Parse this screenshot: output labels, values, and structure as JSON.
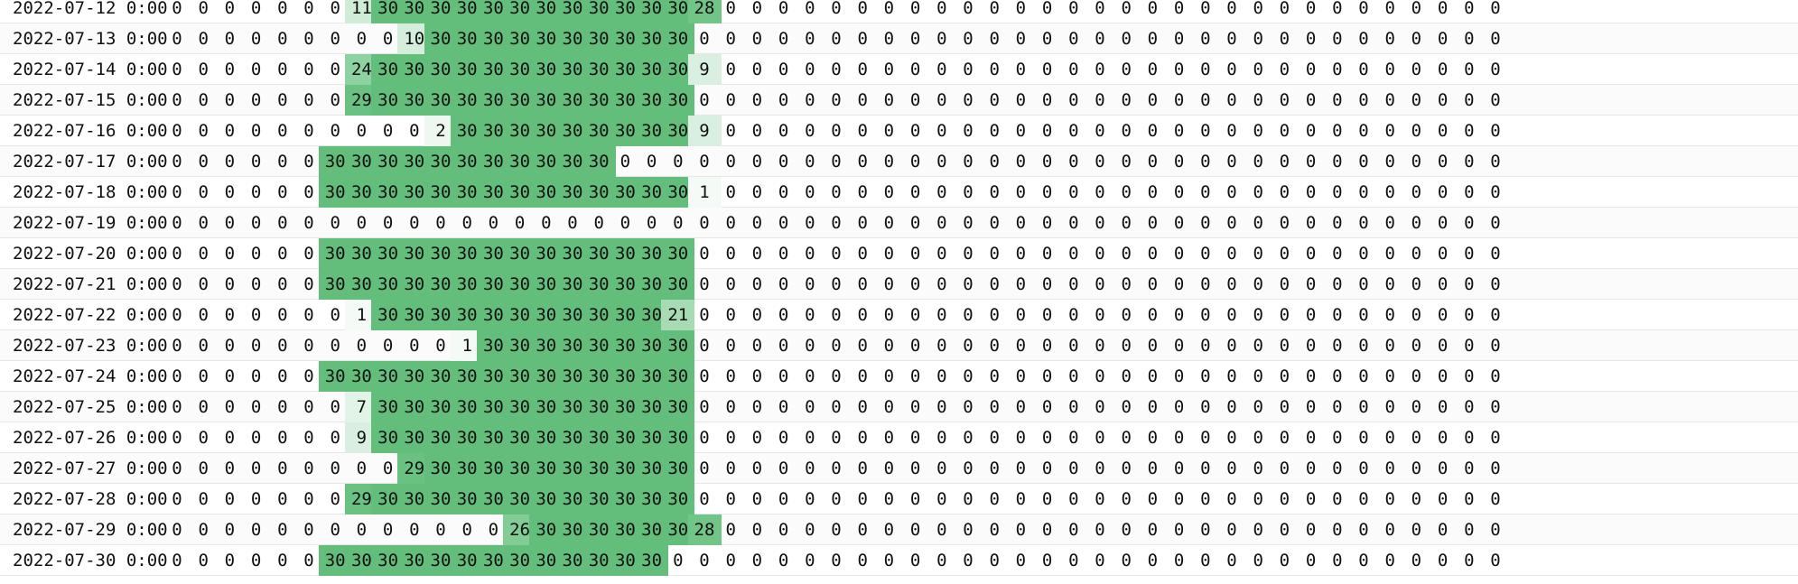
{
  "sheet": {
    "rows": [
      {
        "date": "2022-07-12 0:00",
        "values": [
          0,
          0,
          0,
          0,
          0,
          0,
          0,
          11,
          30,
          30,
          30,
          30,
          30,
          30,
          30,
          30,
          30,
          30,
          30,
          30,
          28,
          0,
          0,
          0,
          0,
          0,
          0,
          0,
          0,
          0,
          0,
          0,
          0,
          0,
          0,
          0,
          0,
          0,
          0,
          0,
          0,
          0,
          0,
          0,
          0,
          0,
          0,
          0,
          0,
          0,
          0
        ]
      },
      {
        "date": "2022-07-13 0:00",
        "values": [
          0,
          0,
          0,
          0,
          0,
          0,
          0,
          0,
          0,
          10,
          30,
          30,
          30,
          30,
          30,
          30,
          30,
          30,
          30,
          30,
          0,
          0,
          0,
          0,
          0,
          0,
          0,
          0,
          0,
          0,
          0,
          0,
          0,
          0,
          0,
          0,
          0,
          0,
          0,
          0,
          0,
          0,
          0,
          0,
          0,
          0,
          0,
          0,
          0,
          0,
          0
        ]
      },
      {
        "date": "2022-07-14 0:00",
        "values": [
          0,
          0,
          0,
          0,
          0,
          0,
          0,
          24,
          30,
          30,
          30,
          30,
          30,
          30,
          30,
          30,
          30,
          30,
          30,
          30,
          9,
          0,
          0,
          0,
          0,
          0,
          0,
          0,
          0,
          0,
          0,
          0,
          0,
          0,
          0,
          0,
          0,
          0,
          0,
          0,
          0,
          0,
          0,
          0,
          0,
          0,
          0,
          0,
          0,
          0,
          0
        ]
      },
      {
        "date": "2022-07-15 0:00",
        "values": [
          0,
          0,
          0,
          0,
          0,
          0,
          0,
          29,
          30,
          30,
          30,
          30,
          30,
          30,
          30,
          30,
          30,
          30,
          30,
          30,
          0,
          0,
          0,
          0,
          0,
          0,
          0,
          0,
          0,
          0,
          0,
          0,
          0,
          0,
          0,
          0,
          0,
          0,
          0,
          0,
          0,
          0,
          0,
          0,
          0,
          0,
          0,
          0,
          0,
          0,
          0
        ]
      },
      {
        "date": "2022-07-16 0:00",
        "values": [
          0,
          0,
          0,
          0,
          0,
          0,
          0,
          0,
          0,
          0,
          2,
          30,
          30,
          30,
          30,
          30,
          30,
          30,
          30,
          30,
          9,
          0,
          0,
          0,
          0,
          0,
          0,
          0,
          0,
          0,
          0,
          0,
          0,
          0,
          0,
          0,
          0,
          0,
          0,
          0,
          0,
          0,
          0,
          0,
          0,
          0,
          0,
          0,
          0,
          0,
          0
        ]
      },
      {
        "date": "2022-07-17 0:00",
        "values": [
          0,
          0,
          0,
          0,
          0,
          0,
          30,
          30,
          30,
          30,
          30,
          30,
          30,
          30,
          30,
          30,
          30,
          0,
          0,
          0,
          0,
          0,
          0,
          0,
          0,
          0,
          0,
          0,
          0,
          0,
          0,
          0,
          0,
          0,
          0,
          0,
          0,
          0,
          0,
          0,
          0,
          0,
          0,
          0,
          0,
          0,
          0,
          0,
          0,
          0,
          0
        ]
      },
      {
        "date": "2022-07-18 0:00",
        "values": [
          0,
          0,
          0,
          0,
          0,
          0,
          30,
          30,
          30,
          30,
          30,
          30,
          30,
          30,
          30,
          30,
          30,
          30,
          30,
          30,
          1,
          0,
          0,
          0,
          0,
          0,
          0,
          0,
          0,
          0,
          0,
          0,
          0,
          0,
          0,
          0,
          0,
          0,
          0,
          0,
          0,
          0,
          0,
          0,
          0,
          0,
          0,
          0,
          0,
          0,
          0
        ]
      },
      {
        "date": "2022-07-19 0:00",
        "values": [
          0,
          0,
          0,
          0,
          0,
          0,
          0,
          0,
          0,
          0,
          0,
          0,
          0,
          0,
          0,
          0,
          0,
          0,
          0,
          0,
          0,
          0,
          0,
          0,
          0,
          0,
          0,
          0,
          0,
          0,
          0,
          0,
          0,
          0,
          0,
          0,
          0,
          0,
          0,
          0,
          0,
          0,
          0,
          0,
          0,
          0,
          0,
          0,
          0,
          0,
          0
        ]
      },
      {
        "date": "2022-07-20 0:00",
        "values": [
          0,
          0,
          0,
          0,
          0,
          0,
          30,
          30,
          30,
          30,
          30,
          30,
          30,
          30,
          30,
          30,
          30,
          30,
          30,
          30,
          0,
          0,
          0,
          0,
          0,
          0,
          0,
          0,
          0,
          0,
          0,
          0,
          0,
          0,
          0,
          0,
          0,
          0,
          0,
          0,
          0,
          0,
          0,
          0,
          0,
          0,
          0,
          0,
          0,
          0,
          0
        ]
      },
      {
        "date": "2022-07-21 0:00",
        "values": [
          0,
          0,
          0,
          0,
          0,
          0,
          30,
          30,
          30,
          30,
          30,
          30,
          30,
          30,
          30,
          30,
          30,
          30,
          30,
          30,
          0,
          0,
          0,
          0,
          0,
          0,
          0,
          0,
          0,
          0,
          0,
          0,
          0,
          0,
          0,
          0,
          0,
          0,
          0,
          0,
          0,
          0,
          0,
          0,
          0,
          0,
          0,
          0,
          0,
          0,
          0
        ]
      },
      {
        "date": "2022-07-22 0:00",
        "values": [
          0,
          0,
          0,
          0,
          0,
          0,
          0,
          1,
          30,
          30,
          30,
          30,
          30,
          30,
          30,
          30,
          30,
          30,
          30,
          21,
          0,
          0,
          0,
          0,
          0,
          0,
          0,
          0,
          0,
          0,
          0,
          0,
          0,
          0,
          0,
          0,
          0,
          0,
          0,
          0,
          0,
          0,
          0,
          0,
          0,
          0,
          0,
          0,
          0,
          0,
          0
        ]
      },
      {
        "date": "2022-07-23 0:00",
        "values": [
          0,
          0,
          0,
          0,
          0,
          0,
          0,
          0,
          0,
          0,
          0,
          1,
          30,
          30,
          30,
          30,
          30,
          30,
          30,
          30,
          0,
          0,
          0,
          0,
          0,
          0,
          0,
          0,
          0,
          0,
          0,
          0,
          0,
          0,
          0,
          0,
          0,
          0,
          0,
          0,
          0,
          0,
          0,
          0,
          0,
          0,
          0,
          0,
          0,
          0,
          0
        ]
      },
      {
        "date": "2022-07-24 0:00",
        "values": [
          0,
          0,
          0,
          0,
          0,
          0,
          30,
          30,
          30,
          30,
          30,
          30,
          30,
          30,
          30,
          30,
          30,
          30,
          30,
          30,
          0,
          0,
          0,
          0,
          0,
          0,
          0,
          0,
          0,
          0,
          0,
          0,
          0,
          0,
          0,
          0,
          0,
          0,
          0,
          0,
          0,
          0,
          0,
          0,
          0,
          0,
          0,
          0,
          0,
          0,
          0
        ]
      },
      {
        "date": "2022-07-25 0:00",
        "values": [
          0,
          0,
          0,
          0,
          0,
          0,
          0,
          7,
          30,
          30,
          30,
          30,
          30,
          30,
          30,
          30,
          30,
          30,
          30,
          30,
          0,
          0,
          0,
          0,
          0,
          0,
          0,
          0,
          0,
          0,
          0,
          0,
          0,
          0,
          0,
          0,
          0,
          0,
          0,
          0,
          0,
          0,
          0,
          0,
          0,
          0,
          0,
          0,
          0,
          0,
          0
        ]
      },
      {
        "date": "2022-07-26 0:00",
        "values": [
          0,
          0,
          0,
          0,
          0,
          0,
          0,
          9,
          30,
          30,
          30,
          30,
          30,
          30,
          30,
          30,
          30,
          30,
          30,
          30,
          0,
          0,
          0,
          0,
          0,
          0,
          0,
          0,
          0,
          0,
          0,
          0,
          0,
          0,
          0,
          0,
          0,
          0,
          0,
          0,
          0,
          0,
          0,
          0,
          0,
          0,
          0,
          0,
          0,
          0,
          0
        ]
      },
      {
        "date": "2022-07-27 0:00",
        "values": [
          0,
          0,
          0,
          0,
          0,
          0,
          0,
          0,
          0,
          29,
          30,
          30,
          30,
          30,
          30,
          30,
          30,
          30,
          30,
          30,
          0,
          0,
          0,
          0,
          0,
          0,
          0,
          0,
          0,
          0,
          0,
          0,
          0,
          0,
          0,
          0,
          0,
          0,
          0,
          0,
          0,
          0,
          0,
          0,
          0,
          0,
          0,
          0,
          0,
          0,
          0
        ]
      },
      {
        "date": "2022-07-28 0:00",
        "values": [
          0,
          0,
          0,
          0,
          0,
          0,
          0,
          29,
          30,
          30,
          30,
          30,
          30,
          30,
          30,
          30,
          30,
          30,
          30,
          30,
          0,
          0,
          0,
          0,
          0,
          0,
          0,
          0,
          0,
          0,
          0,
          0,
          0,
          0,
          0,
          0,
          0,
          0,
          0,
          0,
          0,
          0,
          0,
          0,
          0,
          0,
          0,
          0,
          0,
          0,
          0
        ]
      },
      {
        "date": "2022-07-29 0:00",
        "values": [
          0,
          0,
          0,
          0,
          0,
          0,
          0,
          0,
          0,
          0,
          0,
          0,
          0,
          26,
          30,
          30,
          30,
          30,
          30,
          30,
          28,
          0,
          0,
          0,
          0,
          0,
          0,
          0,
          0,
          0,
          0,
          0,
          0,
          0,
          0,
          0,
          0,
          0,
          0,
          0,
          0,
          0,
          0,
          0,
          0,
          0,
          0,
          0,
          0,
          0,
          0
        ]
      },
      {
        "date": "2022-07-30 0:00",
        "values": [
          0,
          0,
          0,
          0,
          0,
          0,
          30,
          30,
          30,
          30,
          30,
          30,
          30,
          30,
          30,
          30,
          30,
          30,
          30,
          0,
          0,
          0,
          0,
          0,
          0,
          0,
          0,
          0,
          0,
          0,
          0,
          0,
          0,
          0,
          0,
          0,
          0,
          0,
          0,
          0,
          0,
          0,
          0,
          0,
          0,
          0,
          0,
          0,
          0,
          0,
          0
        ]
      }
    ]
  },
  "colors": {
    "scale_high": "#63be7b",
    "scale_low": "#ffffff",
    "text": "#111111",
    "gridline": "#e6e6e6"
  }
}
